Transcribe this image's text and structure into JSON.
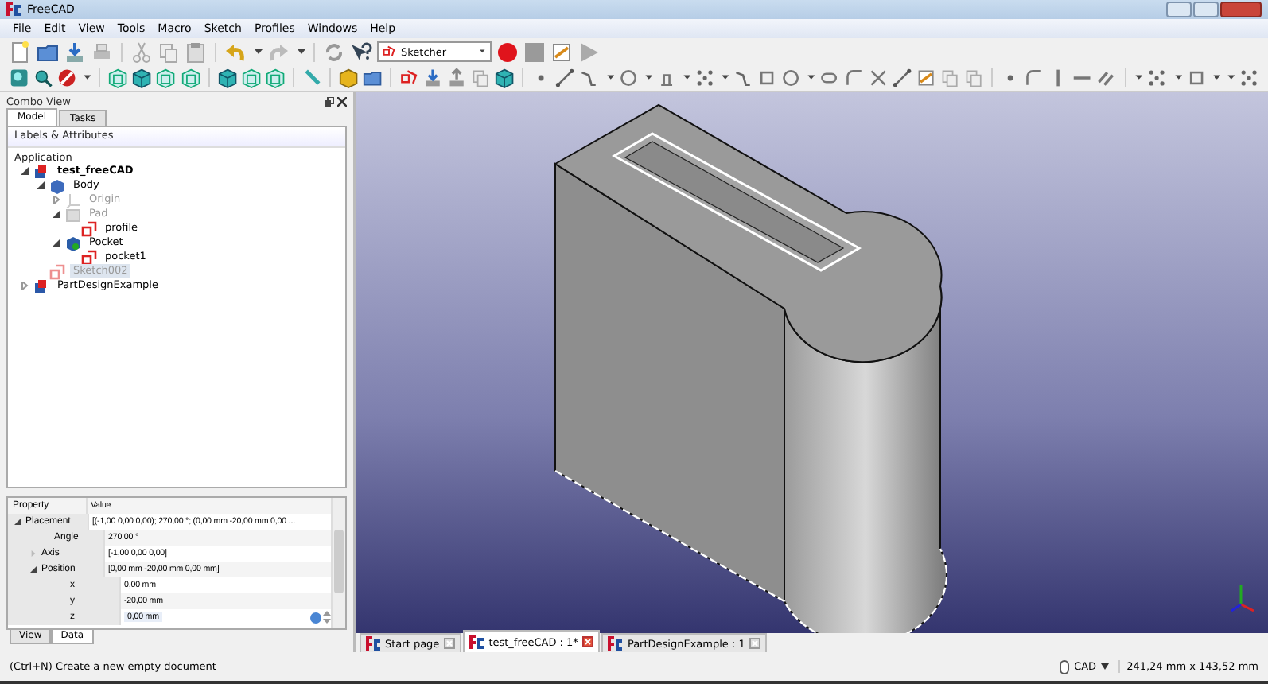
{
  "window": {
    "title": "FreeCAD"
  },
  "menu": [
    "File",
    "Edit",
    "View",
    "Tools",
    "Macro",
    "Sketch",
    "Profiles",
    "Windows",
    "Help"
  ],
  "workbench": {
    "value": "Sketcher"
  },
  "combo_view": {
    "title": "Combo View",
    "tabs": [
      {
        "label": "Model",
        "selected": true
      },
      {
        "label": "Tasks",
        "selected": false
      }
    ],
    "tree": {
      "header": "Labels & Attributes",
      "root": "Application",
      "items": [
        {
          "label": "test_freeCAD",
          "kind": "document",
          "expanded": true,
          "active": true,
          "dimmed": false,
          "selected": false,
          "children": [
            {
              "label": "Body",
              "kind": "body",
              "expanded": true,
              "active": false,
              "dimmed": false,
              "selected": false,
              "children": [
                {
                  "label": "Origin",
                  "kind": "origin",
                  "expanded": false,
                  "active": false,
                  "dimmed": true,
                  "selected": false
                },
                {
                  "label": "Pad",
                  "kind": "pad",
                  "expanded": true,
                  "active": false,
                  "dimmed": true,
                  "selected": false,
                  "children": [
                    {
                      "label": "profile",
                      "kind": "sketch",
                      "active": false,
                      "dimmed": false,
                      "selected": false
                    }
                  ]
                },
                {
                  "label": "Pocket",
                  "kind": "pocket",
                  "expanded": true,
                  "active": false,
                  "dimmed": false,
                  "selected": false,
                  "children": [
                    {
                      "label": "pocket1",
                      "kind": "sketch",
                      "active": false,
                      "dimmed": false,
                      "selected": false
                    }
                  ]
                }
              ]
            },
            {
              "label": "Sketch002",
              "kind": "sketch",
              "active": false,
              "dimmed": true,
              "selected": true
            }
          ]
        },
        {
          "label": "PartDesignExample",
          "kind": "document",
          "expanded": false,
          "active": false,
          "dimmed": false,
          "selected": false
        }
      ]
    },
    "properties": {
      "columns": [
        "Property",
        "Value"
      ],
      "rows": [
        {
          "name": "Placement",
          "value": "[(-1,00 0,00 0,00); 270,00 °; (0,00 mm  -20,00 mm  0,00 ...",
          "expanded": true,
          "editing": false,
          "children": [
            {
              "name": "Angle",
              "value": "270,00 °",
              "editing": false
            },
            {
              "name": "Axis",
              "value": "[-1,00 0,00 0,00]",
              "expanded": false,
              "editing": false
            },
            {
              "name": "Position",
              "value": "[0,00 mm  -20,00 mm  0,00 mm]",
              "expanded": true,
              "editing": false,
              "children": [
                {
                  "name": "x",
                  "value": "0,00 mm",
                  "editing": false
                },
                {
                  "name": "y",
                  "value": "-20,00 mm",
                  "editing": false
                },
                {
                  "name": "z",
                  "value": "0,00 mm",
                  "editing": true
                }
              ]
            }
          ]
        }
      ],
      "tabs": [
        {
          "label": "View",
          "selected": false
        },
        {
          "label": "Data",
          "selected": true
        }
      ]
    }
  },
  "document_tabs": [
    {
      "label": "Start page",
      "selected": false
    },
    {
      "label": "test_freeCAD : 1*",
      "selected": true
    },
    {
      "label": "PartDesignExample : 1",
      "selected": false
    }
  ],
  "status_bar": {
    "message": "(Ctrl+N) Create a new empty document",
    "navigation": "CAD",
    "dimensions": "241,24 mm x 143,52 mm"
  }
}
